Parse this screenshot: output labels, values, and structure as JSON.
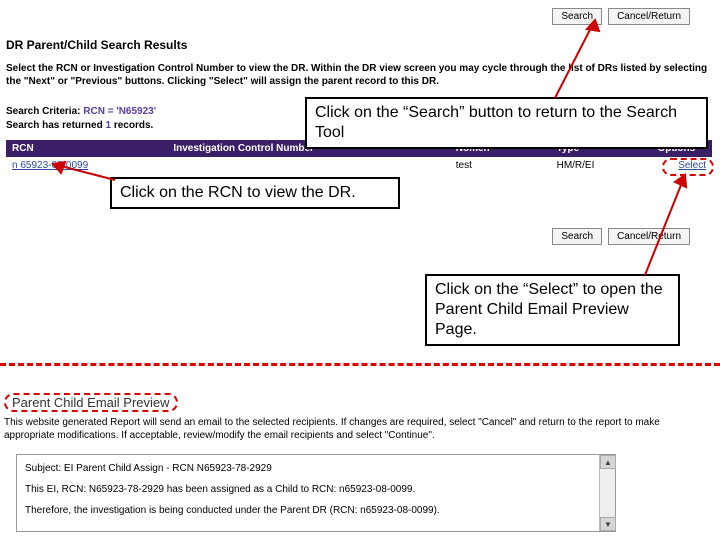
{
  "buttons": {
    "search": "Search",
    "cancel": "Cancel/Return"
  },
  "page_title": "DR Parent/Child Search Results",
  "instructions": "Select the RCN or Investigation Control Number to view the DR. Within the DR view screen you may cycle through the list of DRs listed by selecting the \"Next\" or \"Previous\" buttons. Clicking \"Select\" will assign the parent record to this DR.",
  "criteria": {
    "label": "Search Criteria:",
    "value": "RCN = 'N65923'"
  },
  "returned": {
    "prefix": "Search has returned",
    "count": "1",
    "suffix": "records."
  },
  "table": {
    "headers": [
      "RCN",
      "Investigation Control Number",
      "Nomen",
      "Type",
      "Options"
    ],
    "row": {
      "rcn": "n 65923-08-0099",
      "icn": "",
      "nomen": "test",
      "type": "HM/R/EI",
      "select": "Select"
    }
  },
  "callouts": {
    "search": "Click on the “Search” button to return to the Search Tool",
    "rcn": "Click on the RCN to view the DR.",
    "select": "Click on the “Select” to open the Parent Child Email Preview Page."
  },
  "preview": {
    "title": "Parent Child Email Preview",
    "desc": "This website generated Report will send an email to the selected recipients. If changes are required, select \"Cancel\" and return to the report to make appropriate modifications. If acceptable, review/modify the email recipients and select \"Continue\".",
    "subject_label": "Subject:",
    "subject_value": "EI Parent Child Assign - RCN N65923-78-2929",
    "line1": "This EI, RCN: N65923-78-2929 has been assigned as a Child to RCN: n65923-08-0099.",
    "line2": "Therefore, the investigation is being conducted under the Parent DR (RCN: n65923-08-0099)."
  }
}
